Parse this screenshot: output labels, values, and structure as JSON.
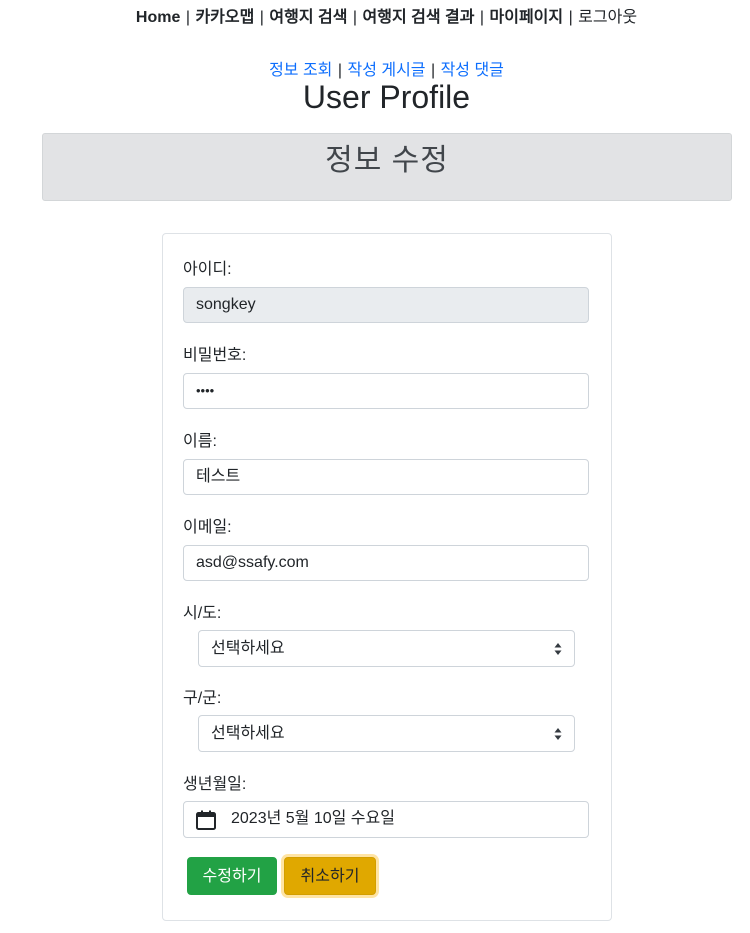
{
  "topnav": {
    "items": [
      "Home",
      "카카오맵",
      "여행지 검색",
      "여행지 검색 결과",
      "마이페이지",
      "로그아웃"
    ],
    "separator": "|"
  },
  "subnav": {
    "items": [
      "정보 조회",
      "작성 게시글",
      "작성 댓글"
    ],
    "separator": "|"
  },
  "page_title": "User Profile",
  "banner_title": "정보 수정",
  "form": {
    "id_label": "아이디:",
    "id_value": "songkey",
    "password_label": "비밀번호:",
    "password_value": "••••",
    "name_label": "이름:",
    "name_value": "테스트",
    "email_label": "이메일:",
    "email_value": "asd@ssafy.com",
    "sido_label": "시/도:",
    "sido_value": "선택하세요",
    "gugun_label": "구/군:",
    "gugun_value": "선택하세요",
    "birth_label": "생년월일:",
    "birth_value": "2023년 5월 10일 수요일",
    "submit_label": "수정하기",
    "cancel_label": "취소하기"
  },
  "colors": {
    "link": "#0d6efd",
    "success": "#22a245",
    "warning": "#e0a800",
    "banner_bg": "#e2e3e5",
    "readonly_bg": "#e9ecef"
  }
}
